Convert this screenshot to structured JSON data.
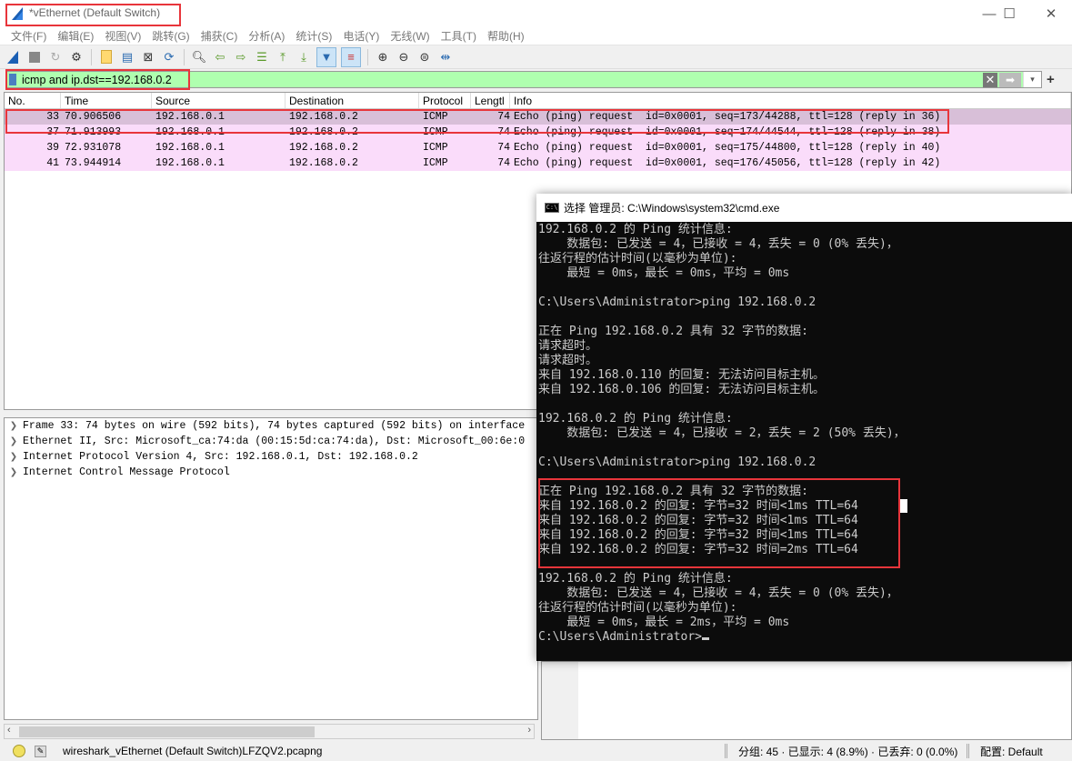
{
  "window": {
    "title": "*vEthernet (Default Switch)",
    "controls": {
      "minimize": "—",
      "maximize": "☐",
      "close": "✕"
    }
  },
  "menu": [
    "文件(F)",
    "编辑(E)",
    "视图(V)",
    "跳转(G)",
    "捕获(C)",
    "分析(A)",
    "统计(S)",
    "电话(Y)",
    "无线(W)",
    "工具(T)",
    "帮助(H)"
  ],
  "toolbar": {
    "icons": [
      "start-capture",
      "stop-capture",
      "restart-capture",
      "capture-options",
      "open-file",
      "save-file",
      "close-file",
      "reload-file",
      "find-packet",
      "go-back",
      "go-forward",
      "go-to-packet",
      "go-first",
      "go-last",
      "auto-scroll",
      "colorize",
      "zoom-in",
      "zoom-out",
      "zoom-normal",
      "resize-columns"
    ]
  },
  "filter": {
    "value": "icmp and ip.dst==192.168.0.2",
    "clear": "✕",
    "apply": "➡",
    "dropdown": "▾",
    "add": "+"
  },
  "packet_list": {
    "columns": [
      "No.",
      "Time",
      "Source",
      "Destination",
      "Protocol",
      "Lengtl",
      "Info"
    ],
    "rows": [
      {
        "no": "33",
        "time": "70.906506",
        "src": "192.168.0.1",
        "dst": "192.168.0.2",
        "proto": "ICMP",
        "len": "74",
        "info": "Echo (ping) request  id=0x0001, seq=173/44288, ttl=128 (reply in 36)",
        "selected": true
      },
      {
        "no": "37",
        "time": "71.913993",
        "src": "192.168.0.1",
        "dst": "192.168.0.2",
        "proto": "ICMP",
        "len": "74",
        "info": "Echo (ping) request  id=0x0001, seq=174/44544, ttl=128 (reply in 38)"
      },
      {
        "no": "39",
        "time": "72.931078",
        "src": "192.168.0.1",
        "dst": "192.168.0.2",
        "proto": "ICMP",
        "len": "74",
        "info": "Echo (ping) request  id=0x0001, seq=175/44800, ttl=128 (reply in 40)"
      },
      {
        "no": "41",
        "time": "73.944914",
        "src": "192.168.0.1",
        "dst": "192.168.0.2",
        "proto": "ICMP",
        "len": "74",
        "info": "Echo (ping) request  id=0x0001, seq=176/45056, ttl=128 (reply in 42)"
      }
    ]
  },
  "details": [
    "Frame 33: 74 bytes on wire (592 bits), 74 bytes captured (592 bits) on interface",
    "Ethernet II, Src: Microsoft_ca:74:da (00:15:5d:ca:74:da), Dst: Microsoft_00:6e:0",
    "Internet Protocol Version 4, Src: 192.168.0.1, Dst: 192.168.0.2",
    "Internet Control Message Protocol"
  ],
  "statusbar": {
    "file": "wireshark_vEthernet (Default Switch)LFZQV2.pcapng",
    "stats": "分组: 45 · 已显示: 4 (8.9%) · 已丢弃: 0 (0.0%)",
    "profile": "配置: Default"
  },
  "cmd": {
    "title": "选择 管理员: C:\\Windows\\system32\\cmd.exe",
    "icon_text": "C:\\",
    "lines_top": "192.168.0.2 的 Ping 统计信息:\n    数据包: 已发送 = 4，已接收 = 4，丢失 = 0 (0% 丢失)，\n往返行程的估计时间(以毫秒为单位):\n    最短 = 0ms，最长 = 0ms，平均 = 0ms\n\nC:\\Users\\Administrator>ping 192.168.0.2\n\n正在 Ping 192.168.0.2 具有 32 字节的数据:\n请求超时。\n请求超时。\n来自 192.168.0.110 的回复: 无法访问目标主机。\n来自 192.168.0.106 的回复: 无法访问目标主机。\n\n192.168.0.2 的 Ping 统计信息:\n    数据包: 已发送 = 4，已接收 = 2，丢失 = 2 (50% 丢失)，\n\nC:\\Users\\Administrator>ping 192.168.0.2\n",
    "lines_highlight": "\n正在 Ping 192.168.0.2 具有 32 字节的数据:\n来自 192.168.0.2 的回复: 字节=32 时间<1ms TTL=64\n来自 192.168.0.2 的回复: 字节=32 时间<1ms TTL=64\n来自 192.168.0.2 的回复: 字节=32 时间<1ms TTL=64\n来自 192.168.0.2 的回复: 字节=32 时间=2ms TTL=64\n",
    "lines_bottom": "\n192.168.0.2 的 Ping 统计信息:\n    数据包: 已发送 = 4，已接收 = 4，丢失 = 0 (0% 丢失)，\n往返行程的估计时间(以毫秒为单位):\n    最短 = 0ms，最长 = 2ms，平均 = 0ms\n",
    "prompt": "C:\\Users\\Administrator>"
  },
  "colors": {
    "highlight_box": "#e8353b",
    "filter_bg": "#afffaf",
    "row_bg": "#fadcfa",
    "row_selected": "#d8bfd8"
  }
}
